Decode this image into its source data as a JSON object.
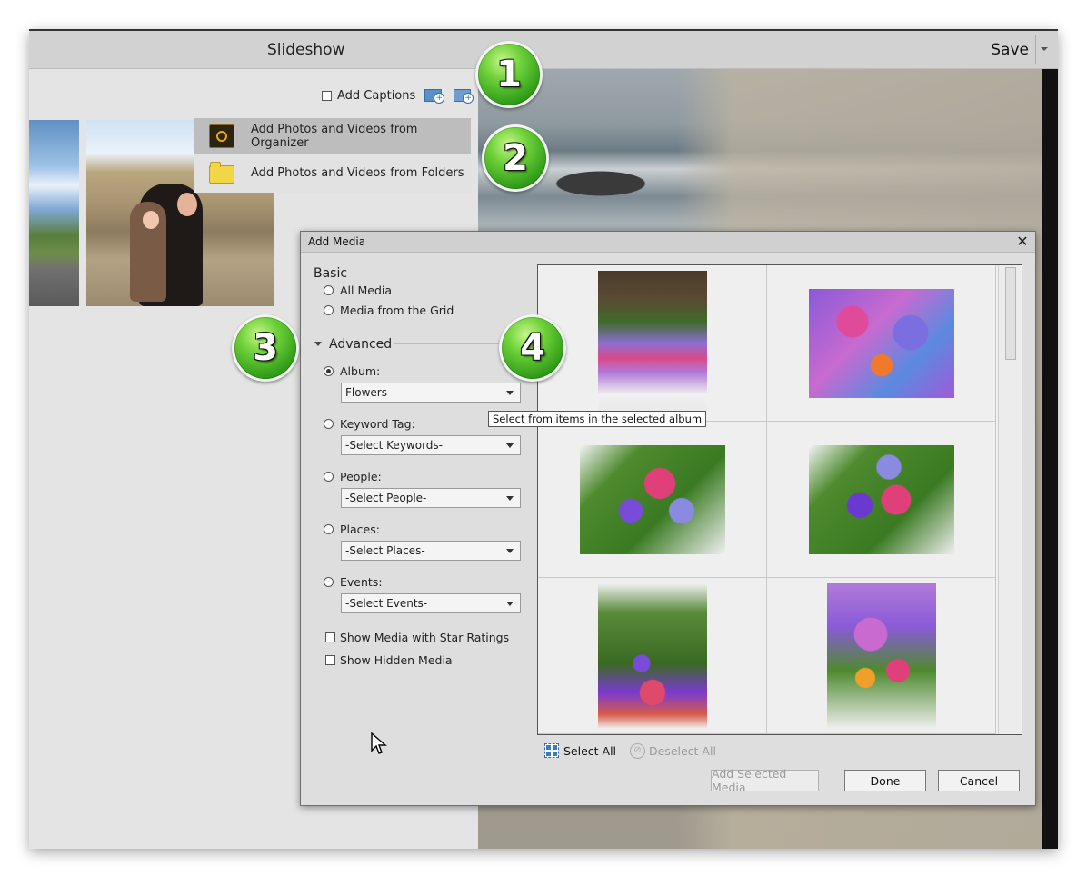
{
  "app": {
    "title": "Slideshow",
    "save_label": "Save"
  },
  "captions": {
    "label": "Add Captions",
    "icons": [
      "add-text-caption-icon",
      "add-image-caption-icon"
    ]
  },
  "add_menu": {
    "items": [
      {
        "label": "Add Photos and Videos from Organizer",
        "icon": "organizer-icon"
      },
      {
        "label": "Add Photos and Videos from Folders",
        "icon": "folder-icon"
      }
    ]
  },
  "badges": [
    "1",
    "2",
    "3",
    "4"
  ],
  "dialog": {
    "title": "Add Media",
    "close": "✕",
    "basic": {
      "heading": "Basic",
      "options": [
        "All Media",
        "Media from the Grid"
      ]
    },
    "advanced": {
      "heading": "Advanced",
      "filters": [
        {
          "label": "Album:",
          "value": "Flowers",
          "selected": true
        },
        {
          "label": "Keyword Tag:",
          "value": "-Select Keywords-",
          "selected": false
        },
        {
          "label": "People:",
          "value": "-Select People-",
          "selected": false
        },
        {
          "label": "Places:",
          "value": "-Select Places-",
          "selected": false
        },
        {
          "label": "Events:",
          "value": "-Select Events-",
          "selected": false
        }
      ],
      "checkboxes": [
        "Show Media with Star Ratings",
        "Show Hidden Media"
      ]
    },
    "tooltip": "Select from items in the selected album",
    "select_all": "Select All",
    "deselect_all": "Deselect All",
    "buttons": {
      "add_selected": "Add Selected Media",
      "done": "Done",
      "cancel": "Cancel"
    }
  },
  "colors": {
    "badge_green": "#2e9a17",
    "accent_blue": "#3a7cc1"
  }
}
